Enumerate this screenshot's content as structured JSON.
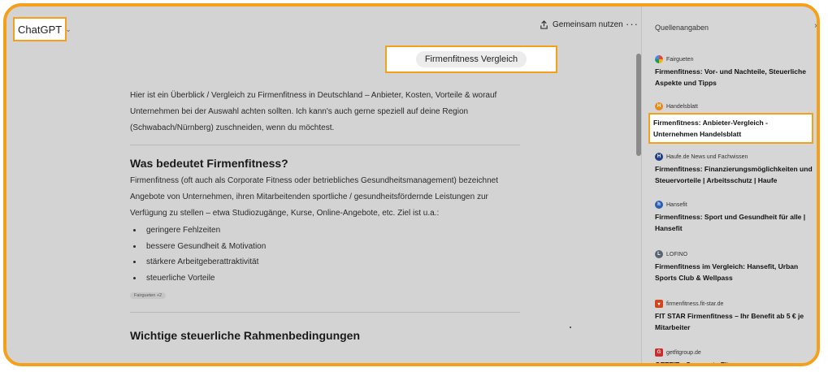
{
  "header": {
    "model_label": "ChatGPT",
    "share_label": "Gemeinsam nutzen",
    "more_label": "···"
  },
  "query": "Firmenfitness Vergleich",
  "main": {
    "intro": "Hier ist ein Überblick / Vergleich zu Firmenfitness in Deutschland – Anbieter, Kosten, Vorteile & worauf Unternehmen bei der Auswahl achten sollten. Ich kann's auch gerne speziell auf deine Region (Schwabach/Nürnberg) zuschneiden, wenn du möchtest.",
    "section1_heading": "Was bedeutet Firmenfitness?",
    "section1_text": "Firmenfitness (oft auch als Corporate Fitness oder betriebliches Gesundheitsmanagement) bezeichnet Angebote von Unternehmen, ihren Mitarbeitenden sportliche / gesundheitsfördernde Leistungen zur Verfügung zu stellen – etwa Studiozugänge, Kurse, Online-Angebote, etc. Ziel ist u.a.:",
    "bullets": [
      "geringere Fehlzeiten",
      "bessere Gesundheit & Motivation",
      "stärkere Arbeitgeberattraktivität",
      "steuerliche Vorteile"
    ],
    "chip": "Fairgueten +2",
    "section2_heading": "Wichtige steuerliche Rahmenbedingungen"
  },
  "sidebar": {
    "title": "Quellenangaben",
    "close_label": "×",
    "sources": [
      {
        "site": "Fairgueten",
        "title": "Firmenfitness: Vor- und Nachteile, Steuerliche Aspekte und Tipps",
        "color": "#3b82f6",
        "icon": "fairgueten-icon"
      },
      {
        "site": "Handelsblatt",
        "title": "Firmenfitness: Anbieter-Vergleich - Unternehmen Handelsblatt",
        "color": "#e8891a",
        "icon": "handelsblatt-icon"
      },
      {
        "site": "Haufe.de News und Fachwissen",
        "title": "Firmenfitness: Finanzierungsmöglichkeiten und Steuervorteile | Arbeitsschutz | Haufe",
        "color": "#1f3f8a",
        "icon": "haufe-icon"
      },
      {
        "site": "Hansefit",
        "title": "Firmenfitness: Sport und Gesundheit für alle | Hansefit",
        "color": "#2b5fb3",
        "icon": "hansefit-icon"
      },
      {
        "site": "LOFINO",
        "title": "Firmenfitness im Vergleich: Hansefit, Urban Sports Club & Wellpass",
        "color": "#5a6470",
        "icon": "lofino-icon"
      },
      {
        "site": "firmenfitness.fit-star.de",
        "title": "FIT STAR Firmenfitness – Ihr Benefit ab 5 € je Mitarbeiter",
        "color": "#d4441c",
        "icon": "fitstar-icon"
      },
      {
        "site": "getfitgroup.de",
        "title": "GETFIT - Corporate Fitness",
        "color": "#d12a2a",
        "icon": "getfit-icon"
      }
    ]
  },
  "colors": {
    "highlight": "#f5a01a",
    "overlay": "#d3d3d3"
  }
}
